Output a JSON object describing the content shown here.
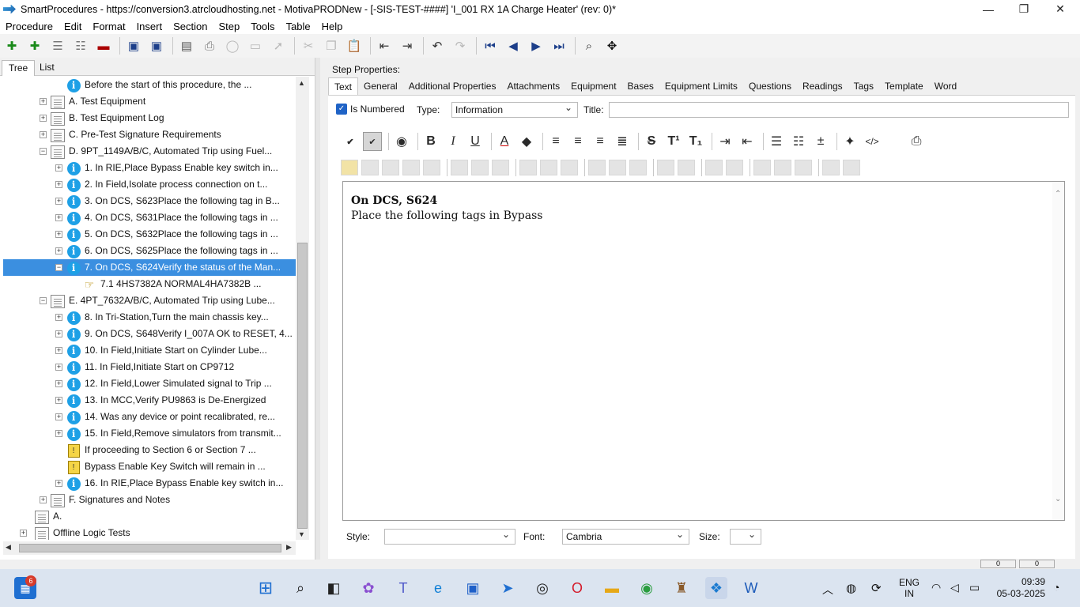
{
  "window": {
    "title": "SmartProcedures - https://conversion3.atrcloudhosting.net - MotivaPRODNew - [-SIS-TEST-####] 'I_001 RX 1A Charge Heater' (rev: 0)*",
    "minimize": "—",
    "restore": "❐",
    "close": "✕"
  },
  "menu": [
    "Procedure",
    "Edit",
    "Format",
    "Insert",
    "Section",
    "Step",
    "Tools",
    "Table",
    "Help"
  ],
  "left_tabs": {
    "tree": "Tree",
    "list": "List"
  },
  "tree": [
    {
      "label": "Before the start of this procedure, the ...",
      "icon": "info",
      "indent": 2,
      "expander": ""
    },
    {
      "label": "A. Test Equipment",
      "icon": "doc",
      "indent": 1,
      "expander": "+"
    },
    {
      "label": "B. Test Equipment Log",
      "icon": "doc",
      "indent": 1,
      "expander": "+"
    },
    {
      "label": "C. Pre-Test Signature Requirements",
      "icon": "doc",
      "indent": 1,
      "expander": "+"
    },
    {
      "label": "D. 9PT_1149A/B/C, Automated Trip using Fuel...",
      "icon": "doc",
      "indent": 1,
      "expander": "−"
    },
    {
      "label": "1. In RIE,Place Bypass Enable key switch in...",
      "icon": "info",
      "indent": 2,
      "expander": "+"
    },
    {
      "label": "2. In Field,Isolate process connection on t...",
      "icon": "info",
      "indent": 2,
      "expander": "+"
    },
    {
      "label": "3. On DCS, S623Place the following tag in B...",
      "icon": "info",
      "indent": 2,
      "expander": "+"
    },
    {
      "label": "4. On DCS, S631Place the following tags in ...",
      "icon": "info",
      "indent": 2,
      "expander": "+"
    },
    {
      "label": "5. On DCS, S632Place the following tags in ...",
      "icon": "info",
      "indent": 2,
      "expander": "+"
    },
    {
      "label": "6. On DCS, S625Place the following tags in ...",
      "icon": "info",
      "indent": 2,
      "expander": "+"
    },
    {
      "label": "7. On DCS, S624Verify the status of the Man...",
      "icon": "info",
      "indent": 2,
      "expander": "−",
      "selected": true
    },
    {
      "label": "7.1 4HS7382A         NORMAL4HA7382B         ...",
      "icon": "hand",
      "indent": 3,
      "expander": ""
    },
    {
      "label": "E. 4PT_7632A/B/C, Automated Trip using Lube...",
      "icon": "doc",
      "indent": 1,
      "expander": "−"
    },
    {
      "label": "8. In Tri-Station,Turn the main chassis key...",
      "icon": "info",
      "indent": 2,
      "expander": "+"
    },
    {
      "label": "9. On DCS, S648Verify I_007A OK to RESET, 4...",
      "icon": "info",
      "indent": 2,
      "expander": "+"
    },
    {
      "label": "10. In Field,Initiate Start on Cylinder Lube...",
      "icon": "info",
      "indent": 2,
      "expander": "+"
    },
    {
      "label": "11. In Field,Initiate Start on CP9712",
      "icon": "info",
      "indent": 2,
      "expander": "+"
    },
    {
      "label": "12. In Field,Lower Simulated signal to Trip ...",
      "icon": "info",
      "indent": 2,
      "expander": "+"
    },
    {
      "label": "13. In MCC,Verify PU9863 is De-Energized",
      "icon": "info",
      "indent": 2,
      "expander": "+"
    },
    {
      "label": "14. Was any device or point recalibrated, re...",
      "icon": "info",
      "indent": 2,
      "expander": "+"
    },
    {
      "label": "15. In Field,Remove simulators from transmit...",
      "icon": "info",
      "indent": 2,
      "expander": "+"
    },
    {
      "label": "If proceeding to Section 6 or Section 7 ...",
      "icon": "warn",
      "indent": 2,
      "expander": ""
    },
    {
      "label": "Bypass Enable Key Switch will remain in ...",
      "icon": "warn",
      "indent": 2,
      "expander": ""
    },
    {
      "label": "16. In RIE,Place Bypass Enable key switch in...",
      "icon": "info",
      "indent": 2,
      "expander": "+"
    },
    {
      "label": "F. Signatures and Notes",
      "icon": "doc",
      "indent": 1,
      "expander": "+"
    },
    {
      "label": "A.",
      "icon": "doc",
      "indent": 0,
      "expander": ""
    },
    {
      "label": "Offline Logic Tests",
      "icon": "doc",
      "indent": 0,
      "expander": "+"
    }
  ],
  "step_properties": {
    "title": "Step Properties:",
    "tabs": [
      "Text",
      "General",
      "Additional Properties",
      "Attachments",
      "Equipment",
      "Bases",
      "Equipment Limits",
      "Questions",
      "Readings",
      "Tags",
      "Template",
      "Word"
    ],
    "is_numbered_label": "Is Numbered",
    "type_label": "Type:",
    "type_value": "Information",
    "title_label": "Title:",
    "title_value": "",
    "editor_line1": "On DCS, S624",
    "editor_line2": "Place the following tags in Bypass",
    "style_label": "Style:",
    "style_value": "",
    "font_label": "Font:",
    "font_value": "Cambria",
    "size_label": "Size:",
    "size_value": ""
  },
  "taskbar": {
    "badge": "6",
    "lang_line1": "ENG",
    "lang_line2": "IN",
    "time": "09:39",
    "date": "05-03-2025"
  },
  "status": {
    "left_cell": "0",
    "right_cell": "0"
  }
}
